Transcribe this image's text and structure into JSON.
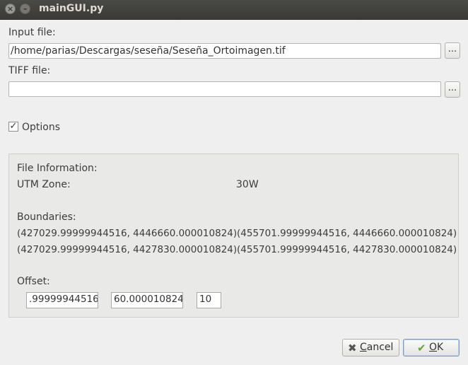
{
  "window": {
    "title": "mainGUI.py",
    "close_glyph": "×",
    "minimize_glyph": "–"
  },
  "input_file": {
    "label": "Input file:",
    "value": "/home/parias/Descargas/seseña/Seseña_Ortoimagen.tif",
    "browse_label": "..."
  },
  "tiff_file": {
    "label": "TIFF file:",
    "value": "",
    "browse_label": "..."
  },
  "options": {
    "label": "Options",
    "checked": true,
    "check_glyph": "✓"
  },
  "file_info": {
    "heading": "File Information:",
    "utm_label": "UTM Zone:",
    "utm_value": "30W",
    "boundaries_label": "Boundaries:",
    "boundaries": [
      [
        "(427029.99999944516, 4446660.000010824)",
        "(455701.99999944516, 4446660.000010824)"
      ],
      [
        "(427029.99999944516, 4427830.000010824)",
        "(455701.99999944516, 4427830.000010824)"
      ]
    ],
    "offset_label": "Offset:",
    "offset_values": [
      ".99999944516",
      "60.000010824",
      "10"
    ]
  },
  "buttons": {
    "cancel": {
      "label_underlined": "C",
      "label_rest": "ancel",
      "icon": "cancel-icon",
      "glyph": "✖"
    },
    "ok": {
      "label_underlined": "O",
      "label_rest": "K",
      "icon": "check-icon",
      "glyph": "✔"
    }
  },
  "colors": {
    "titlebar": "#3b3a37",
    "title_text": "#dfdbd2",
    "ok_check": "#6aa33a",
    "cancel_x": "#555555",
    "ok_border": "#7e9bc4"
  }
}
